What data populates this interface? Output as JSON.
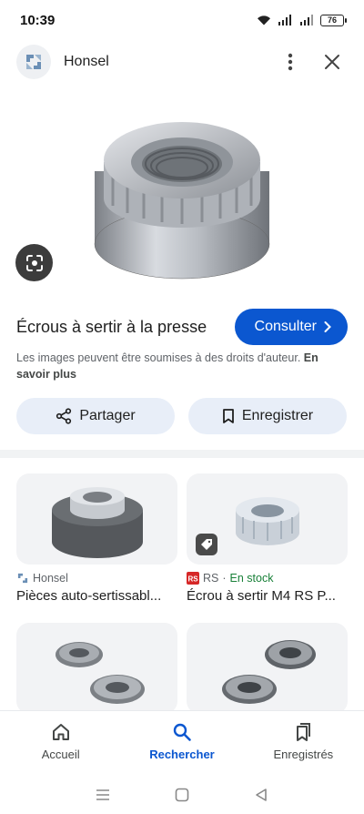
{
  "status_bar": {
    "time": "10:39",
    "battery": "76",
    "network_1": "4G",
    "network_2": "4G"
  },
  "header": {
    "site_name": "Honsel",
    "menu_icon": "more-vert-icon",
    "close_icon": "close-icon"
  },
  "hero": {
    "alt": "Écrous à sertir à la presse"
  },
  "product": {
    "title": "Écrous à sertir à la presse",
    "visit_label": "Consulter",
    "copyright_text": "Les images peuvent être soumises à des droits d'auteur.",
    "learn_more": "En savoir plus"
  },
  "actions": {
    "share_label": "Partager",
    "save_label": "Enregistrer"
  },
  "related": [
    {
      "source": "Honsel",
      "title": "Pièces auto-sertissabl...",
      "stock": ""
    },
    {
      "source": "RS",
      "title": "Écrou à sertir M4 RS P...",
      "stock": "En stock"
    },
    {
      "source": "",
      "title": "",
      "stock": ""
    },
    {
      "source": "",
      "title": "",
      "stock": ""
    }
  ],
  "bottom_nav": [
    {
      "label": "Accueil",
      "icon": "home-icon",
      "active": false
    },
    {
      "label": "Rechercher",
      "icon": "search-icon",
      "active": true
    },
    {
      "label": "Enregistrés",
      "icon": "bookmarks-icon",
      "active": false
    }
  ],
  "colors": {
    "accent": "#0b57d0",
    "chip_bg": "#e8eef8",
    "stock": "#188038"
  }
}
